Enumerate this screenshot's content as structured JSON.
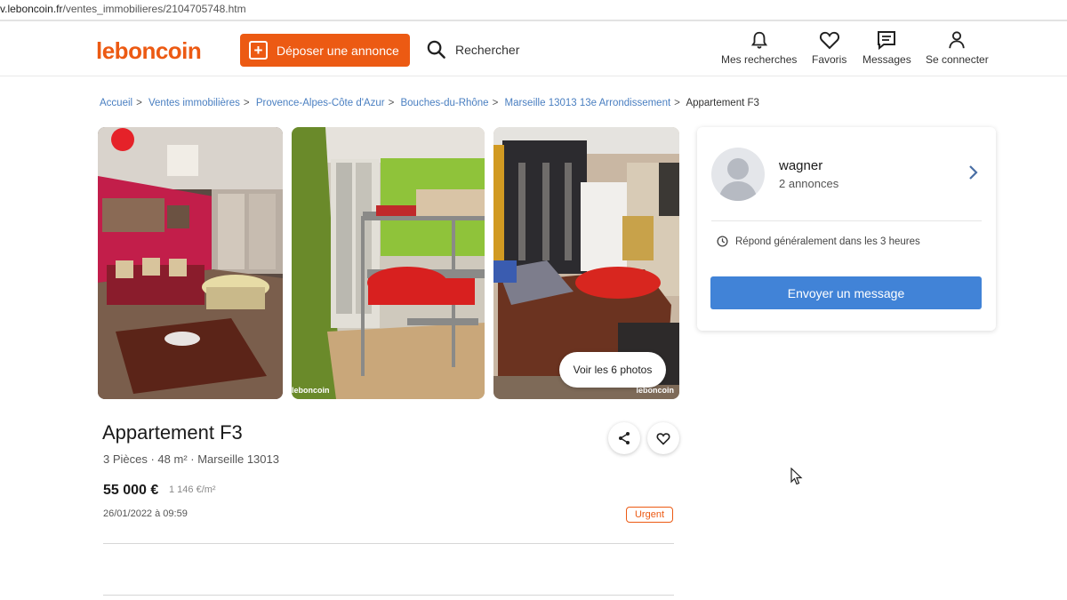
{
  "browser": {
    "url_host": "v.leboncoin.fr",
    "url_path": "/ventes_immobilieres/2104705748.htm"
  },
  "header": {
    "logo": "leboncoin",
    "post_button": "Déposer une annonce",
    "search": "Rechercher",
    "nav": [
      {
        "label": "Mes recherches",
        "icon": "bell-icon"
      },
      {
        "label": "Favoris",
        "icon": "heart-icon"
      },
      {
        "label": "Messages",
        "icon": "message-icon"
      },
      {
        "label": "Se connecter",
        "icon": "user-icon"
      }
    ]
  },
  "breadcrumb": {
    "items": [
      "Accueil",
      "Ventes immobilières",
      "Provence-Alpes-Côte d'Azur",
      "Bouches-du-Rhône",
      "Marseille 13013 13e Arrondissement"
    ],
    "current": "Appartement F3",
    "separator": ">"
  },
  "gallery": {
    "watermark": "leboncoin",
    "more_button": "Voir les 6 photos"
  },
  "listing": {
    "title": "Appartement F3",
    "subtitle": "3 Pièces · 48 m² · Marseille 13013",
    "price": "55 000 €",
    "price_per_m2": "1 146 €/m²",
    "date": "26/01/2022 à 09:59",
    "badge": "Urgent"
  },
  "seller": {
    "name": "wagner",
    "ads_count": "2 annonces",
    "reply_time": "Répond généralement dans les 3 heures",
    "message_button": "Envoyer un message"
  },
  "colors": {
    "brand": "#ec5a13",
    "link": "#4a7fc1",
    "primary_button": "#4183d7"
  }
}
